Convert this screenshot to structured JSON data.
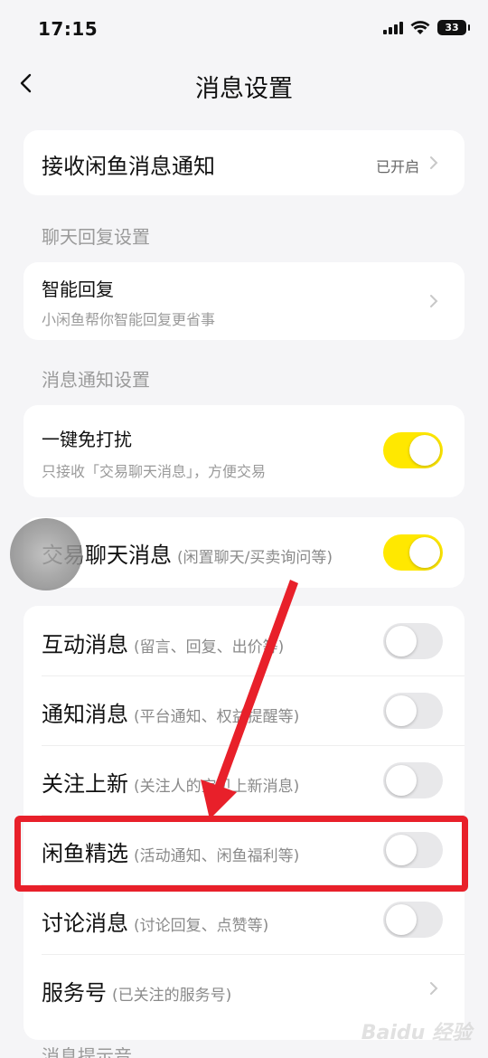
{
  "status": {
    "time": "17:15",
    "battery": "33"
  },
  "nav": {
    "title": "消息设置"
  },
  "receive": {
    "label": "接收闲鱼消息通知",
    "value": "已开启"
  },
  "sections": {
    "chat_reply": "聊天回复设置",
    "notify": "消息通知设置",
    "sound": "消息提示音"
  },
  "smart_reply": {
    "title": "智能回复",
    "subtitle": "小闲鱼帮你智能回复更省事"
  },
  "dnd": {
    "title": "一键免打扰",
    "subtitle": "只接收「交易聊天消息」，方便交易",
    "on": true
  },
  "trade_chat": {
    "title": "交易聊天消息",
    "hint": "(闲置聊天/买卖询问等)",
    "on": true
  },
  "items": [
    {
      "title": "互动消息",
      "hint": "(留言、回复、出价等)",
      "on": false
    },
    {
      "title": "通知消息",
      "hint": "(平台通知、权益提醒等)",
      "on": false
    },
    {
      "title": "关注上新",
      "hint": "(关注人的宝贝上新消息)",
      "on": false
    },
    {
      "title": "闲鱼精选",
      "hint": "(活动通知、闲鱼福利等)",
      "on": false
    },
    {
      "title": "讨论消息",
      "hint": "(讨论回复、点赞等)",
      "on": false
    },
    {
      "title": "服务号",
      "hint": "(已关注的服务号)"
    }
  ],
  "watermark": "Baidu 经验",
  "colors": {
    "toggle_on": "#ffe800",
    "highlight": "#e8202a"
  },
  "icons": [
    "back-arrow-icon",
    "chevron-right-icon",
    "signal-icon",
    "wifi-icon",
    "battery-icon"
  ]
}
